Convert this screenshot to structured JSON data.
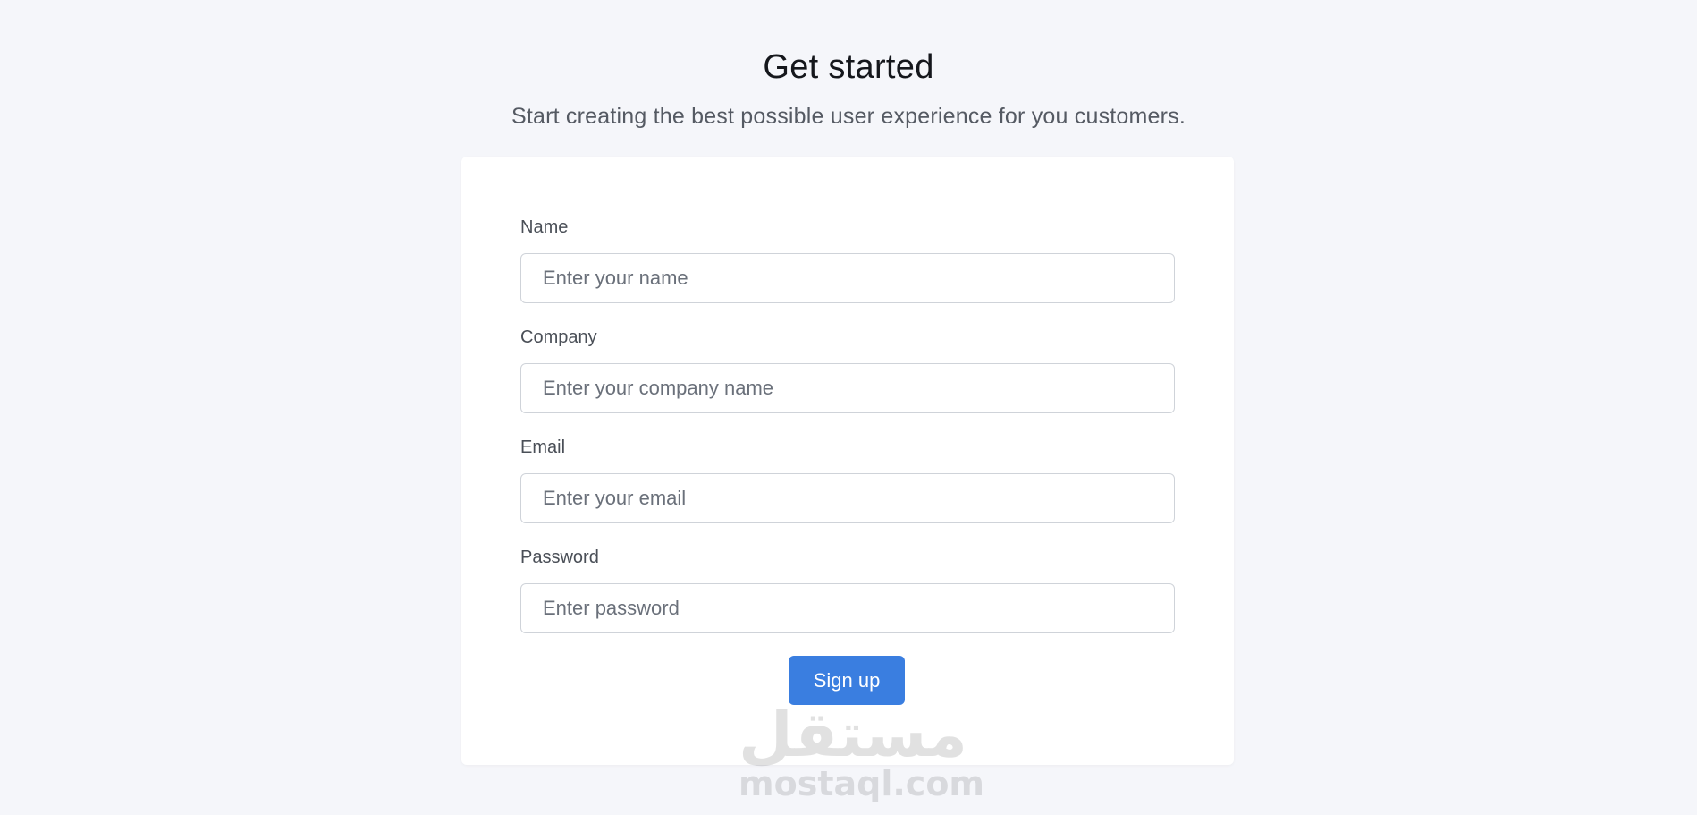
{
  "header": {
    "title": "Get started",
    "subtitle": "Start creating the best possible user experience for you customers."
  },
  "form": {
    "fields": [
      {
        "label": "Name",
        "placeholder": "Enter your name",
        "value": ""
      },
      {
        "label": "Company",
        "placeholder": "Enter your company name",
        "value": ""
      },
      {
        "label": "Email",
        "placeholder": "Enter your email",
        "value": ""
      },
      {
        "label": "Password",
        "placeholder": "Enter password",
        "value": ""
      }
    ],
    "submit_label": "Sign up"
  },
  "watermark": {
    "arabic": "مستقل",
    "latin": "mostaql.com"
  },
  "colors": {
    "background": "#f5f6fa",
    "card": "#ffffff",
    "accent": "#3a7ee0",
    "input_border": "#cfd3d9"
  }
}
